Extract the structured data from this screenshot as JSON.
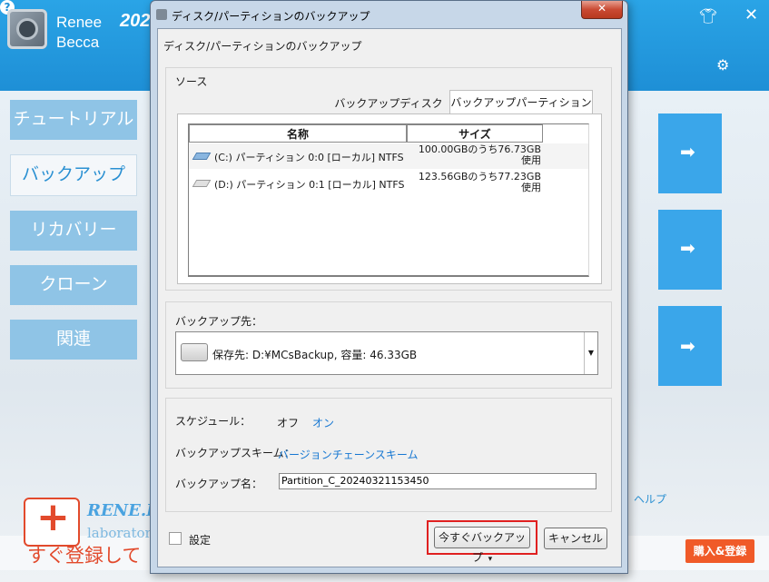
{
  "app": {
    "name_line1": "Renee",
    "name_line2": "Becca",
    "version": "202",
    "sidebar": [
      {
        "label": "チュートリアル",
        "active": false
      },
      {
        "label": "バックアップ",
        "active": true
      },
      {
        "label": "リカバリー",
        "active": false
      },
      {
        "label": "クローン",
        "active": false
      },
      {
        "label": "関連",
        "active": false
      }
    ],
    "arrow": "➡",
    "help_link": "ヘルプ",
    "promo_text": "すぐ登録して",
    "buy_button": "購入&登録",
    "brand": "RENE.E",
    "brand_sub": "laboratory",
    "accent_color": "#2aa4e6",
    "buy_color": "#f05a28"
  },
  "dialog": {
    "title": "ディスク/パーティションのバックアップ",
    "close": "✕",
    "heading": "ディスク/パーティションのバックアップ",
    "source": {
      "label": "ソース",
      "tabs": [
        {
          "label": "バックアップディスク",
          "active": false
        },
        {
          "label": "バックアップパーティション",
          "active": true
        }
      ],
      "columns": {
        "name": "名称",
        "size": "サイズ"
      },
      "rows": [
        {
          "name": "(C:) パーティション 0:0 [ローカル] NTFS",
          "size_line1": "100.00GBのうち76.73GB",
          "size_line2": "使用"
        },
        {
          "name": "(D:) パーティション 0:1 [ローカル] NTFS",
          "size_line1": "123.56GBのうち77.23GB",
          "size_line2": "使用"
        }
      ]
    },
    "destination": {
      "label": "バックアップ先：",
      "value": "保存先: D:¥MCsBackup, 容量: 46.33GB",
      "dropdown_icon": "▼"
    },
    "schedule": {
      "label": "スケジュール：",
      "off": "オフ",
      "on": "オン",
      "scheme_label": "バックアップスキーム：",
      "scheme_value": "バージョンチェーンスキーム",
      "name_label": "バックアップ名：",
      "name_value": "Partition_C_20240321153450"
    },
    "footer": {
      "settings": "設定",
      "backup_now": "今すぐバックアップ",
      "backup_now_arrow": "▾",
      "cancel": "キャンセル"
    }
  }
}
